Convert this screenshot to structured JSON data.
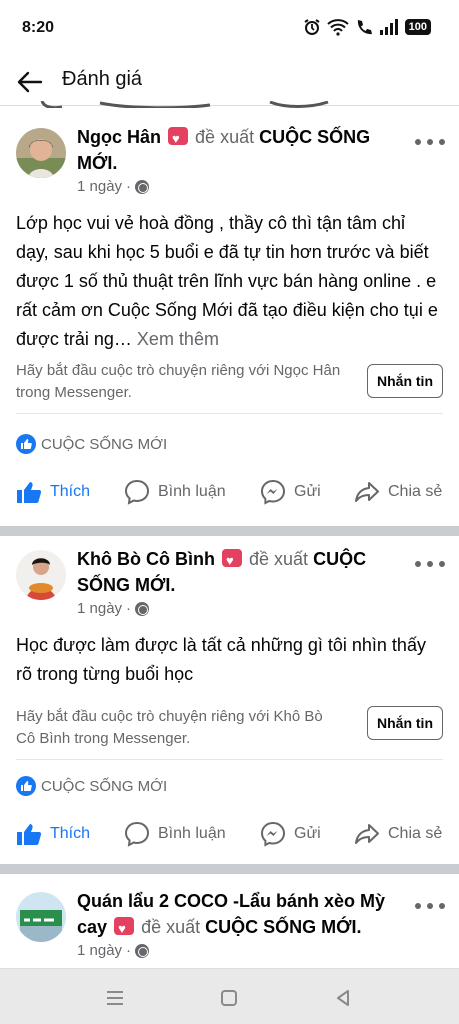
{
  "status_bar": {
    "time": "8:20",
    "battery": "100"
  },
  "header": {
    "title": "Đánh giá"
  },
  "posts": [
    {
      "author": "Ngọc Hân",
      "verb": "đề xuất",
      "page": "CUỘC SỐNG MỚI",
      "time": "1 ngày",
      "body": "Lớp học vui vẻ hoà đồng , thầy cô thì tận tâm chỉ dạy, sau khi học 5 buổi e đã tự tin hơn trước và biết được 1 số thủ thuật trên lĩnh vực bán hàng online . e rất cảm ơn Cuộc Sống Mới đã tạo điều kiện cho tụi e được trải ng…",
      "see_more": "Xem thêm",
      "messenger_prompt": "Hãy bắt đầu cuộc trò chuyện riêng với Ngọc Hân trong Messenger.",
      "message_button": "Nhắn tin",
      "reaction": "CUỘC SỐNG MỚI",
      "actions": {
        "like": "Thích",
        "comment": "Bình luận",
        "send": "Gửi",
        "share": "Chia sẻ"
      }
    },
    {
      "author": "Khô Bò Cô Bình",
      "verb": "đề xuất",
      "page": "CUỘC SỐNG MỚI",
      "time": "1 ngày",
      "body": "Học được làm được là tất cả những gì tôi nhìn thấy rõ trong từng buổi học",
      "messenger_prompt": "Hãy bắt đầu cuộc trò chuyện riêng với Khô Bò Cô Bình  trong Messenger.",
      "message_button": "Nhắn tin",
      "reaction": "CUỘC SỐNG MỚI",
      "actions": {
        "like": "Thích",
        "comment": "Bình luận",
        "send": "Gửi",
        "share": "Chia sẻ"
      }
    },
    {
      "author": "Quán lẩu 2 COCO -Lẩu bánh xèo Mỳ cay",
      "verb": "đề xuất",
      "page": "CUỘC SỐNG MỚI",
      "time": "1 ngày"
    }
  ],
  "colors": {
    "accent": "#1877f2",
    "muted": "#65676b",
    "badge": "#e4405f",
    "separator": "#c9ccd1"
  }
}
